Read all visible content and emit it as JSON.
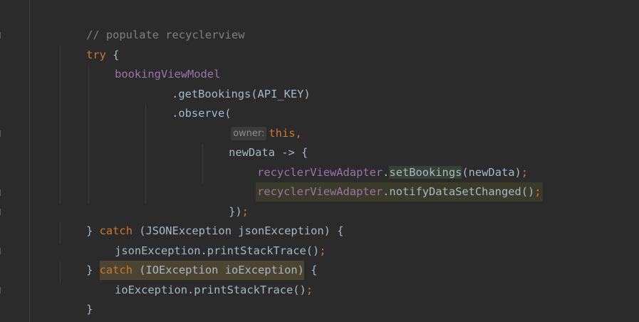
{
  "editor": {
    "lines": {
      "l1": {
        "comment": "// populate recyclerview"
      },
      "l2": {
        "kw_try": "try",
        "brace": " {"
      },
      "l3": {
        "field": "bookingViewModel"
      },
      "l4": {
        "call": ".getBookings(API_KEY)"
      },
      "l5": {
        "call": ".observe("
      },
      "l6": {
        "hint": "owner:",
        "kw_this": "this",
        "comma": ","
      },
      "l7": {
        "code": "newData -> {"
      },
      "l8": {
        "field": "recyclerViewAdapter",
        "dot": ".",
        "method": "setBookings",
        "args": "(newData)",
        "semi": ";"
      },
      "l9": {
        "field": "recyclerViewAdapter",
        "dot": ".",
        "method": "notifyDataSetChanged()",
        "semi": ";"
      },
      "l10": {
        "close": "})",
        "semi": ";"
      },
      "l11": {
        "brace": "} ",
        "kw_catch": "catch",
        "rest": " (JSONException jsonException) {"
      },
      "l12": {
        "call": "jsonException.printStackTrace()",
        "semi": ";"
      },
      "l13": {
        "brace": "} ",
        "kw_catch": "catch",
        "rest": " (IOException ioException)",
        "tail": " {"
      },
      "l14": {
        "call": "ioException.printStackTrace()",
        "semi": ";"
      },
      "l15": {
        "brace": "}"
      }
    },
    "colors": {
      "background": "#2b2b2b",
      "keyword": "#cc7832",
      "field": "#9876aa",
      "comment": "#808080",
      "text": "#a9b7c6"
    }
  }
}
